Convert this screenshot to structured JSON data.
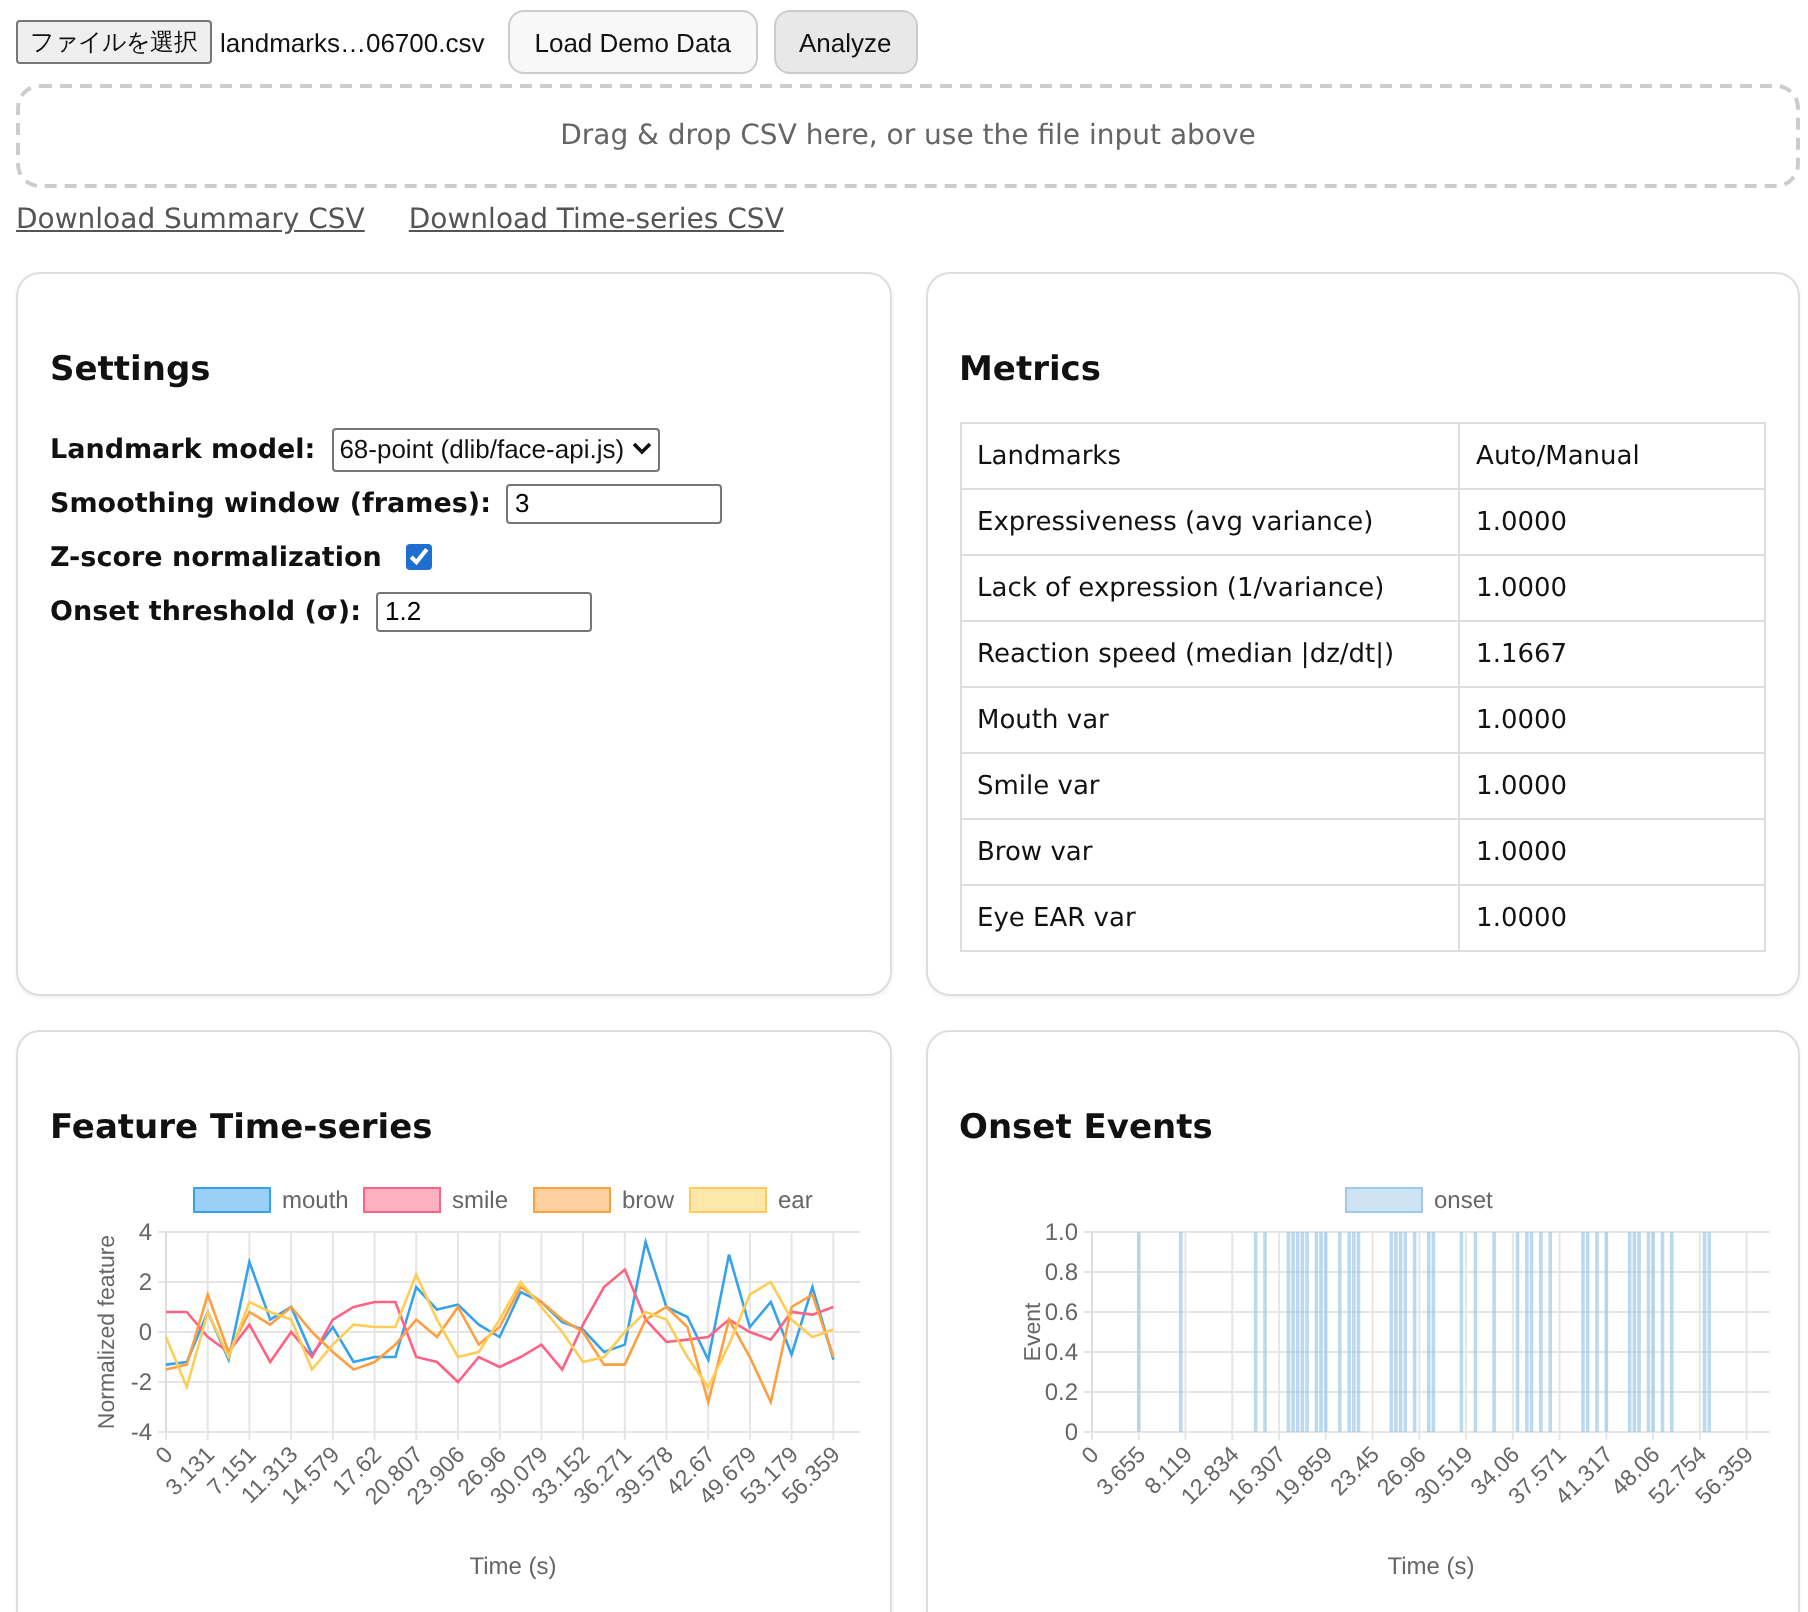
{
  "top_bar": {
    "file_button": "ファイルを選択",
    "file_name": "landmarks…06700.csv",
    "buttons": [
      {
        "label": "Load Demo Data",
        "hovered": false
      },
      {
        "label": "Analyze",
        "hovered": true
      }
    ]
  },
  "drop_zone": {
    "text": "Drag & drop CSV here, or use the file input above"
  },
  "links": [
    "Download Summary CSV",
    "Download Time-series CSV"
  ],
  "settings": {
    "title": "Settings",
    "fields": [
      {
        "kind": "select",
        "label": "Landmark model:",
        "value": "68-point (dlib/face-api.js)"
      },
      {
        "kind": "text",
        "label": "Smoothing window (frames):",
        "value": "3"
      },
      {
        "kind": "checkbox",
        "label": "Z-score normalization",
        "checked": true
      },
      {
        "kind": "text",
        "label": "Onset threshold (σ):",
        "value": "1.2"
      }
    ]
  },
  "metrics": {
    "title": "Metrics",
    "columns": [
      "Landmarks",
      "Auto/Manual"
    ],
    "rows": [
      [
        "Expressiveness (avg variance)",
        "1.0000"
      ],
      [
        "Lack of expression (1/variance)",
        "1.0000"
      ],
      [
        "Reaction speed (median |dz/dt|)",
        "1.1667"
      ],
      [
        "Mouth var",
        "1.0000"
      ],
      [
        "Smile var",
        "1.0000"
      ],
      [
        "Brow var",
        "1.0000"
      ],
      [
        "Eye EAR var",
        "1.0000"
      ]
    ]
  },
  "feature_chart": {
    "title": "Feature Time-series",
    "chart_data": {
      "type": "line",
      "xlabel": "Time (s)",
      "ylabel": "Normalized feature",
      "grid": true,
      "legend": "top",
      "categories": [
        "0",
        null,
        "3.131",
        null,
        "7.151",
        null,
        "11.313",
        null,
        "14.579",
        null,
        "17.62",
        null,
        "20.807",
        null,
        "23.906",
        null,
        "26.96",
        null,
        "30.079",
        null,
        "33.152",
        null,
        "36.271",
        null,
        "39.578",
        null,
        "42.67",
        null,
        "49.679",
        null,
        "53.179",
        null,
        "56.359"
      ],
      "ylim": [
        -4,
        4
      ],
      "yticks": [
        -4,
        -2,
        0,
        2,
        4
      ],
      "series": [
        {
          "name": "mouth",
          "color": "#36a2eb",
          "values": [
            -1.3,
            -1.2,
            0.8,
            -1.1,
            2.8,
            0.5,
            1.0,
            -0.9,
            0.2,
            -1.2,
            -1.0,
            -1.0,
            1.8,
            0.9,
            1.1,
            0.3,
            -0.2,
            1.6,
            1.2,
            0.4,
            0.1,
            -0.8,
            -0.5,
            3.6,
            1.0,
            0.6,
            -1.1,
            3.1,
            0.2,
            1.2,
            -0.9,
            1.8,
            -1.1
          ]
        },
        {
          "name": "smile",
          "color": "#ff6384",
          "values": [
            0.8,
            0.8,
            -0.2,
            -0.8,
            0.3,
            -1.2,
            0.0,
            -1.0,
            0.5,
            1.0,
            1.2,
            1.2,
            -1.0,
            -1.2,
            -2.0,
            -1.0,
            -1.4,
            -1.0,
            -0.5,
            -1.5,
            0.3,
            1.8,
            2.5,
            0.5,
            -0.4,
            -0.3,
            -0.2,
            0.5,
            0.0,
            -0.3,
            0.8,
            0.7,
            1.0
          ]
        },
        {
          "name": "brow",
          "color": "#ff9f40",
          "values": [
            -1.5,
            -1.3,
            1.5,
            -0.8,
            0.8,
            0.3,
            1.0,
            0.0,
            -0.8,
            -1.5,
            -1.2,
            -0.5,
            0.5,
            -0.2,
            1.0,
            -0.5,
            0.2,
            1.8,
            1.2,
            0.5,
            0.0,
            -1.3,
            -1.3,
            0.5,
            1.0,
            0.2,
            -2.8,
            0.5,
            -1.0,
            -2.8,
            1.0,
            1.5,
            -1.0
          ]
        },
        {
          "name": "ear",
          "color": "#ffcd56",
          "values": [
            -0.2,
            -2.2,
            0.8,
            -1.0,
            1.2,
            0.8,
            0.5,
            -1.5,
            -0.5,
            0.3,
            0.2,
            0.2,
            2.3,
            0.5,
            -1.0,
            -0.8,
            0.5,
            2.0,
            1.0,
            0.0,
            -1.2,
            -1.0,
            0.0,
            0.8,
            0.5,
            -1.0,
            -2.2,
            -0.5,
            1.5,
            2.0,
            0.5,
            -0.2,
            0.1
          ]
        }
      ]
    }
  },
  "onset_chart": {
    "title": "Onset Events",
    "chart_data": {
      "type": "bar",
      "xlabel": "Time (s)",
      "ylabel": "Event",
      "grid": true,
      "legend": "top",
      "ylim": [
        0,
        1
      ],
      "yticks": [
        {
          "value": 0,
          "label": "0"
        },
        {
          "value": 0.2,
          "label": "0.2"
        },
        {
          "value": 0.4,
          "label": "0.4"
        },
        {
          "value": 0.6,
          "label": "0.6"
        },
        {
          "value": 0.8,
          "label": "0.8"
        },
        {
          "value": 1,
          "label": "1.0"
        }
      ],
      "categories": [
        "0",
        null,
        null,
        null,
        null,
        null,
        null,
        null,
        null,
        null,
        "3.655",
        null,
        null,
        null,
        null,
        null,
        null,
        null,
        null,
        null,
        "8.119",
        null,
        null,
        null,
        null,
        null,
        null,
        null,
        null,
        null,
        "12.834",
        null,
        null,
        null,
        null,
        null,
        null,
        null,
        null,
        null,
        "16.307",
        null,
        null,
        null,
        null,
        null,
        null,
        null,
        null,
        null,
        "19.859",
        null,
        null,
        null,
        null,
        null,
        null,
        null,
        null,
        null,
        "23.45",
        null,
        null,
        null,
        null,
        null,
        null,
        null,
        null,
        null,
        "26.96",
        null,
        null,
        null,
        null,
        null,
        null,
        null,
        null,
        null,
        "30.519",
        null,
        null,
        null,
        null,
        null,
        null,
        null,
        null,
        null,
        "34.06",
        null,
        null,
        null,
        null,
        null,
        null,
        null,
        null,
        null,
        "37.571",
        null,
        null,
        null,
        null,
        null,
        null,
        null,
        null,
        null,
        "41.317",
        null,
        null,
        null,
        null,
        null,
        null,
        null,
        null,
        null,
        "48.06",
        null,
        null,
        null,
        null,
        null,
        null,
        null,
        null,
        null,
        "52.754",
        null,
        null,
        null,
        null,
        null,
        null,
        null,
        null,
        null,
        "56.359",
        null,
        null,
        null,
        null,
        null
      ],
      "series": [
        {
          "name": "onset",
          "color": "#9ecae9",
          "values": [
            0,
            0,
            0,
            0,
            0,
            0,
            0,
            0,
            0,
            0,
            1,
            0,
            0,
            0,
            0,
            0,
            0,
            0,
            0,
            1,
            0,
            0,
            0,
            0,
            0,
            0,
            0,
            0,
            0,
            0,
            0,
            0,
            0,
            0,
            0,
            1,
            0,
            1,
            0,
            0,
            0,
            0,
            1,
            1,
            1,
            1,
            1,
            0,
            1,
            1,
            1,
            0,
            0,
            1,
            0,
            1,
            1,
            1,
            0,
            0,
            0,
            0,
            0,
            0,
            1,
            1,
            1,
            1,
            0,
            1,
            0,
            0,
            1,
            1,
            0,
            0,
            0,
            0,
            0,
            1,
            0,
            0,
            1,
            0,
            0,
            0,
            1,
            0,
            0,
            0,
            0,
            1,
            0,
            1,
            1,
            0,
            1,
            0,
            1,
            0,
            0,
            0,
            0,
            0,
            0,
            1,
            1,
            0,
            1,
            0,
            1,
            0,
            0,
            0,
            0,
            1,
            1,
            1,
            0,
            1,
            1,
            0,
            1,
            0,
            1,
            0,
            0,
            0,
            0,
            0,
            0,
            1,
            1,
            0,
            0,
            0,
            0,
            0,
            0,
            0,
            0,
            0,
            0,
            0,
            0,
            0
          ]
        }
      ]
    }
  }
}
